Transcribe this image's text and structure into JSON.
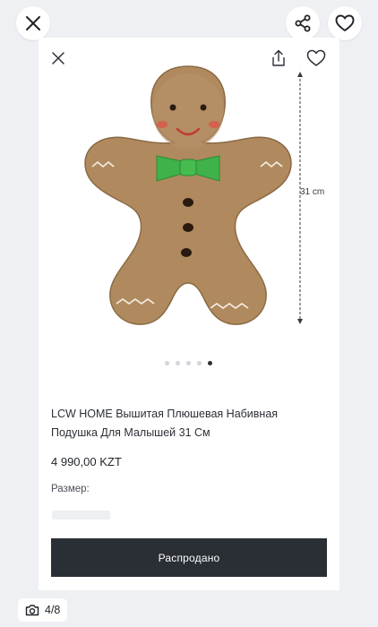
{
  "header": {
    "close_icon": "close-icon",
    "share_icon": "share-icon",
    "favorite_icon": "heart-icon"
  },
  "product": {
    "image_alt": "Gingerbread man plush pillow",
    "dimension_label": "31 cm",
    "title": "LCW HOME Вышитая Плюшевая Набивная Подушка Для Малышей 31 См",
    "price": "4 990,00 KZT",
    "size_label": "Размер:",
    "button_label": "Распродано"
  },
  "gallery": {
    "total": 5,
    "active_index": 4,
    "counter": "4/8"
  },
  "colors": {
    "background": "#eef0f3",
    "button_bg": "#2a2e35",
    "dot_active": "#2b2f36",
    "dot_inactive": "#d2d5da"
  }
}
